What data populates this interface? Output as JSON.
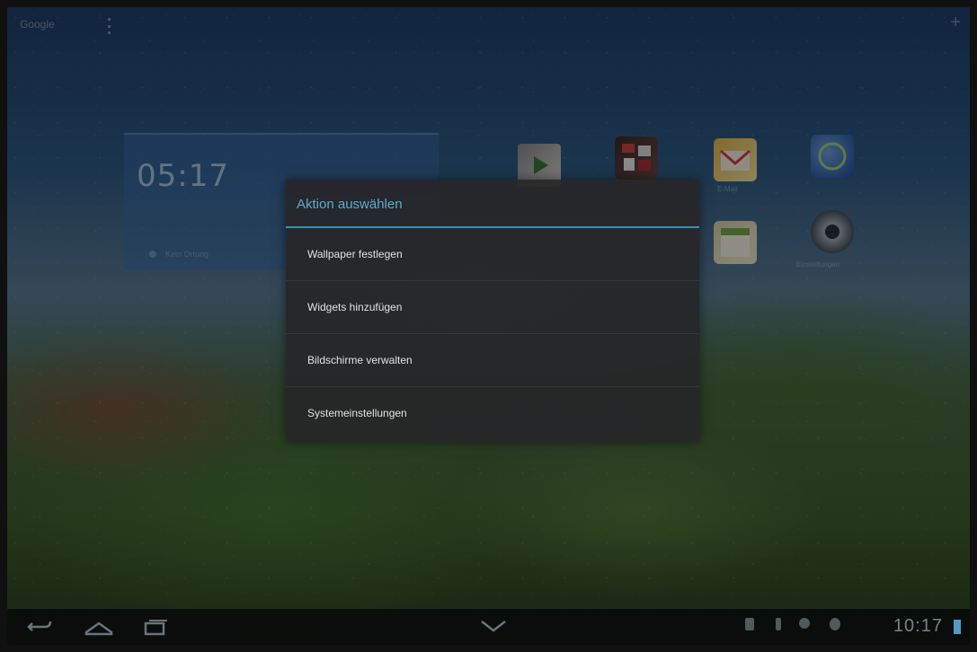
{
  "home": {
    "search_label": "Google",
    "clock_time": "05:17",
    "weather_text": "Kein Ortung",
    "app_labels": [
      "Play Store",
      "Galerie",
      "E-Mail",
      "Browser",
      "Kalender",
      "Einstellungen"
    ]
  },
  "dialog": {
    "title": "Aktion auswählen",
    "items": [
      "Wallpaper festlegen",
      "Widgets hinzufügen",
      "Bildschirme verwalten",
      "Systemeinstellungen"
    ]
  },
  "status": {
    "time": "10:17"
  },
  "colors": {
    "accent": "#3d8fb4",
    "dialog_bg": "#262628"
  },
  "icons": {
    "nav": [
      "back-icon",
      "home-icon",
      "recent-apps-icon",
      "hide-keyboard-icon"
    ],
    "status": [
      "screenshot-icon",
      "usb-icon",
      "signal-icon",
      "bluetooth-icon",
      "battery-icon"
    ]
  }
}
